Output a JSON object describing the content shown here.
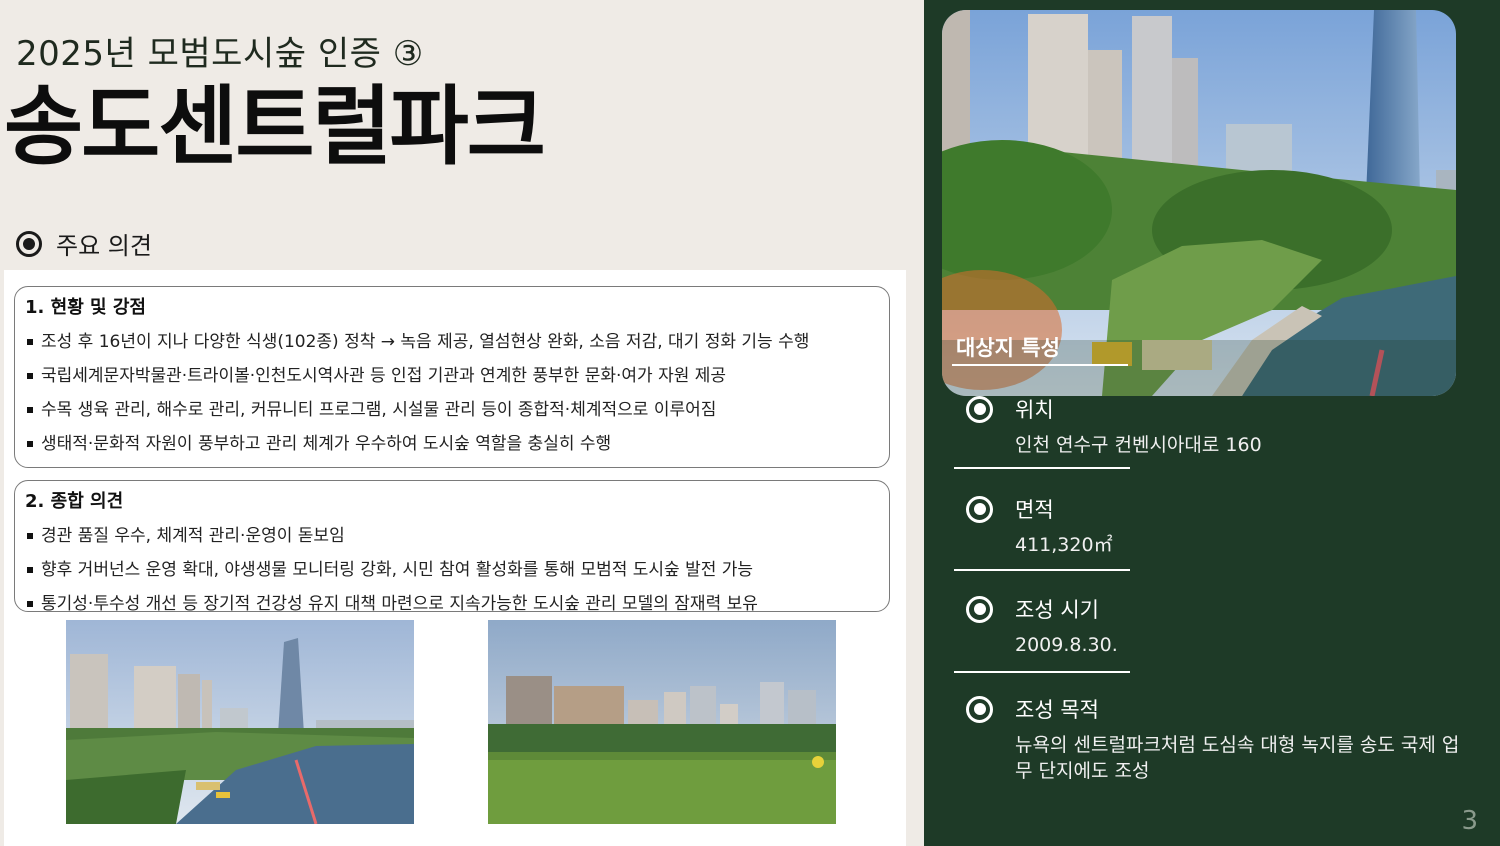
{
  "header": {
    "subtitle": "2025년 모범도시숲 인증 ③",
    "title": "송도센트럴파크"
  },
  "section": {
    "heading": "주요 의견"
  },
  "box1": {
    "title": "1. 현황 및 강점",
    "items": [
      "조성 후 16년이 지나 다양한 식생(102종) 정착 → 녹음 제공, 열섬현상 완화, 소음 저감, 대기 정화 기능 수행",
      "국립세계문자박물관·트라이볼·인천도시역사관 등 인접 기관과 연계한 풍부한 문화·여가 자원 제공",
      "수목 생육 관리, 해수로 관리, 커뮤니티 프로그램, 시설물 관리 등이 종합적·체계적으로 이루어짐",
      "생태적·문화적 자원이 풍부하고 관리 체계가 우수하여 도시숲 역할을 충실히 수행"
    ]
  },
  "box2": {
    "title": "2.  종합 의견",
    "items": [
      "경관 품질 우수, 체계적 관리·운영이 돋보임",
      "향후 거버넌스 운영 확대, 야생생물 모니터링 강화, 시민 참여 활성화를 통해 모범적 도시숲 발전 가능",
      "통기성·투수성 개선 등 장기적 건강성 유지 대책 마련으로 지속가능한 도시숲 관리 모델의 잠재력 보유"
    ]
  },
  "right": {
    "photo_label": "대상지 특성",
    "info": [
      {
        "label": "위치",
        "value": "인천 연수구 컨벤시아대로 160"
      },
      {
        "label": "면적",
        "value": "411,320㎡"
      },
      {
        "label": "조성 시기",
        "value": "2009.8.30."
      },
      {
        "label": "조성 목적",
        "value": "뉴욕의 센트럴파크처럼 도심속 대형 녹지를 송도 국제 업무 단지에도 조성"
      }
    ]
  },
  "page_number": "3"
}
